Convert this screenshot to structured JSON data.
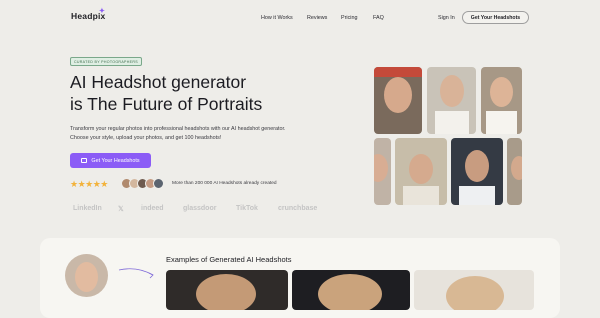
{
  "brand": {
    "name": "Headpix"
  },
  "nav": {
    "items": [
      {
        "label": "How it Works"
      },
      {
        "label": "Reviews"
      },
      {
        "label": "Pricing"
      },
      {
        "label": "FAQ"
      }
    ],
    "signin_label": "Sign In",
    "cta_label": "Get Your Headshots"
  },
  "hero": {
    "badge": "CURATED BY PHOTOGRAPHERS",
    "title_line1": "AI Headshot generator",
    "title_line2": "is The Future of Portraits",
    "lead_line1": "Transform your regular photos into professional headshots with our AI headshot generator.",
    "lead_line2": "Choose your style, upload your photos, and get 100 headshots!",
    "cta_label": "Get Your Headshots",
    "stars": "★★★★★",
    "rating": 5,
    "stat": "More than 200 000 AI Headshots already created"
  },
  "partners": [
    "LinkedIn",
    "𝕏",
    "indeed",
    "glassdoor",
    "TikTok",
    "crunchbase"
  ],
  "examples": {
    "title": "Examples of Generated AI Headshots"
  },
  "colors": {
    "accent": "#8b5cf6",
    "background": "#eeede9",
    "star": "#f2b23a"
  }
}
